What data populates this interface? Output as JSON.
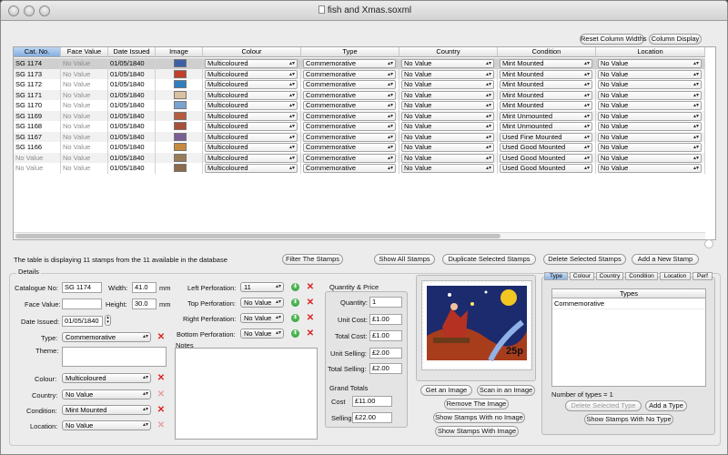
{
  "window": {
    "title": "fish and Xmas.soxml"
  },
  "toolbar": {
    "reset_widths": "Reset Column Widths",
    "column_display": "Column Display"
  },
  "table": {
    "headers": [
      "Cat. No.",
      "Face Value",
      "Date Issued",
      "Image",
      "Colour",
      "Type",
      "Country",
      "Condition",
      "Location"
    ],
    "rows": [
      {
        "cat": "SG 1174",
        "face": "No Value",
        "date": "01/05/1840",
        "colour": "Multicoloured",
        "type": "Commemorative",
        "country": "No Value",
        "condition": "Mint Mounted",
        "location": "No Value"
      },
      {
        "cat": "SG 1173",
        "face": "No Value",
        "date": "01/05/1840",
        "colour": "Multicoloured",
        "type": "Commemorative",
        "country": "No Value",
        "condition": "Mint Mounted",
        "location": "No Value"
      },
      {
        "cat": "SG 1172",
        "face": "No Value",
        "date": "01/05/1840",
        "colour": "Multicoloured",
        "type": "Commemorative",
        "country": "No Value",
        "condition": "Mint Mounted",
        "location": "No Value"
      },
      {
        "cat": "SG 1171",
        "face": "No Value",
        "date": "01/05/1840",
        "colour": "Multicoloured",
        "type": "Commemorative",
        "country": "No Value",
        "condition": "Mint Mounted",
        "location": "No Value"
      },
      {
        "cat": "SG 1170",
        "face": "No Value",
        "date": "01/05/1840",
        "colour": "Multicoloured",
        "type": "Commemorative",
        "country": "No Value",
        "condition": "Mint Mounted",
        "location": "No Value"
      },
      {
        "cat": "SG 1169",
        "face": "No Value",
        "date": "01/05/1840",
        "colour": "Multicoloured",
        "type": "Commemorative",
        "country": "No Value",
        "condition": "Mint Unmounted",
        "location": "No Value"
      },
      {
        "cat": "SG 1168",
        "face": "No Value",
        "date": "01/05/1840",
        "colour": "Multicoloured",
        "type": "Commemorative",
        "country": "No Value",
        "condition": "Mint Unmounted",
        "location": "No Value"
      },
      {
        "cat": "SG 1167",
        "face": "No Value",
        "date": "01/05/1840",
        "colour": "Multicoloured",
        "type": "Commemorative",
        "country": "No Value",
        "condition": "Used Fine Mounted",
        "location": "No Value"
      },
      {
        "cat": "SG 1166",
        "face": "No Value",
        "date": "01/05/1840",
        "colour": "Multicoloured",
        "type": "Commemorative",
        "country": "No Value",
        "condition": "Used Good Mounted",
        "location": "No Value"
      },
      {
        "cat": "No Value",
        "face": "No Value",
        "date": "01/05/1840",
        "colour": "Multicoloured",
        "type": "Commemorative",
        "country": "No Value",
        "condition": "Used Good Mounted",
        "location": "No Value"
      },
      {
        "cat": "No Value",
        "face": "No Value",
        "date": "01/05/1840",
        "colour": "Multicoloured",
        "type": "Commemorative",
        "country": "No Value",
        "condition": "Used Good Mounted",
        "location": "No Value"
      }
    ]
  },
  "status": {
    "text": "The table is displaying 11 stamps from the 11 available in the database"
  },
  "actions": {
    "filter": "Filter The Stamps",
    "show_all": "Show All Stamps",
    "duplicate": "Duplicate Selected Stamps",
    "delete": "Delete Selected Stamps",
    "add": "Add a New Stamp"
  },
  "details": {
    "title": "Details",
    "catalogue_label": "Catalogue No:",
    "catalogue": "SG 1174",
    "width_label": "Width:",
    "width": "41.0",
    "height_label": "Height:",
    "height": "30.0",
    "unit": "mm",
    "face_label": "Face Value:",
    "face": "",
    "date_label": "Date Issued:",
    "date": "01/05/1840",
    "type_label": "Type:",
    "type": "Commemorative",
    "theme_label": "Theme:",
    "colour_label": "Colour:",
    "colour": "Multicoloured",
    "country_label": "Country:",
    "country": "No Value",
    "condition_label": "Condition:",
    "condition": "Mint Mounted",
    "location_label": "Location:",
    "location": "No Value",
    "left_perf_label": "Left Perforation:",
    "left_perf": "11",
    "top_perf_label": "Top Perforation:",
    "top_perf": "No Value",
    "right_perf_label": "Right Perforation:",
    "right_perf": "No Value",
    "bottom_perf_label": "Bottom Perforation:",
    "bottom_perf": "No Value",
    "notes_label": "Notes"
  },
  "price": {
    "title": "Quantity & Price",
    "quantity_label": "Quantity:",
    "quantity": "1",
    "unit_cost_label": "Unit Cost:",
    "unit_cost": "£1.00",
    "total_cost_label": "Total Cost:",
    "total_cost": "£1.00",
    "unit_selling_label": "Unit Selling:",
    "unit_selling": "£2.00",
    "total_selling_label": "Total Selling:",
    "total_selling": "£2.00",
    "grand_title": "Grand Totals",
    "cost_label": "Cost",
    "cost": "£11.00",
    "selling_label": "Selling",
    "selling": "£22.00"
  },
  "image_panel": {
    "stamp_value": "25p",
    "get": "Get an Image",
    "scan": "Scan in an Image",
    "remove": "Remove The Image",
    "no_image": "Show Stamps With no Image",
    "with_image": "Show Stamps With Image"
  },
  "types_panel": {
    "tabs": [
      "Type",
      "Colour",
      "Country",
      "Condition",
      "Location",
      "Perf"
    ],
    "list_header": "Types",
    "items": [
      "Commemorative"
    ],
    "count": "Number of types = 1",
    "delete": "Delete Selected Type",
    "add": "Add a Type",
    "no_type": "Show Stamps With No Type"
  }
}
